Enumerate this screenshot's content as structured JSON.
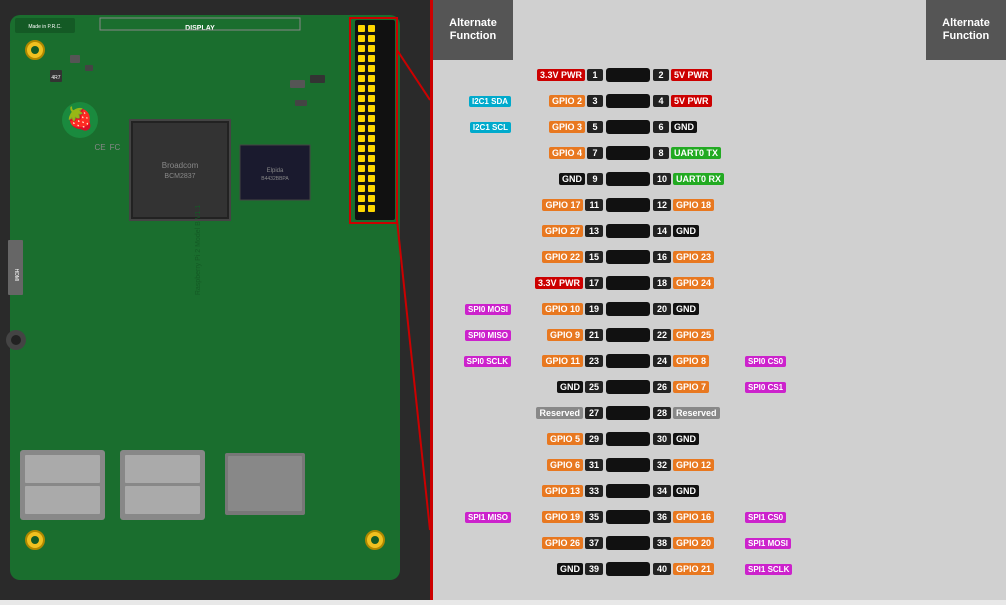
{
  "header": {
    "left_alt_func": "Alternate\nFunction",
    "right_alt_func": "Alternate\nFunction"
  },
  "pins": [
    {
      "left_alt": "",
      "left_label": "3.3V PWR",
      "left_color": "color-red",
      "left_num": "1",
      "right_num": "2",
      "right_label": "5V PWR",
      "right_color": "color-red2",
      "right_alt": ""
    },
    {
      "left_alt": "I2C1 SDA",
      "left_alt_color": "color-cyan",
      "left_label": "GPIO 2",
      "left_color": "color-orange",
      "left_num": "3",
      "right_num": "4",
      "right_label": "5V PWR",
      "right_color": "color-red2",
      "right_alt": ""
    },
    {
      "left_alt": "I2C1 SCL",
      "left_alt_color": "color-cyan",
      "left_label": "GPIO 3",
      "left_color": "color-orange",
      "left_num": "5",
      "right_num": "6",
      "right_label": "GND",
      "right_color": "color-black",
      "right_alt": ""
    },
    {
      "left_alt": "",
      "left_label": "GPIO 4",
      "left_color": "color-orange",
      "left_num": "7",
      "right_num": "8",
      "right_label": "UART0 TX",
      "right_color": "color-green",
      "right_alt": ""
    },
    {
      "left_alt": "",
      "left_label": "GND",
      "left_color": "color-black",
      "left_num": "9",
      "right_num": "10",
      "right_label": "UART0 RX",
      "right_color": "color-green",
      "right_alt": ""
    },
    {
      "left_alt": "",
      "left_label": "GPIO 17",
      "left_color": "color-orange",
      "left_num": "11",
      "right_num": "12",
      "right_label": "GPIO 18",
      "right_color": "color-orange",
      "right_alt": ""
    },
    {
      "left_alt": "",
      "left_label": "GPIO 27",
      "left_color": "color-orange",
      "left_num": "13",
      "right_num": "14",
      "right_label": "GND",
      "right_color": "color-black",
      "right_alt": ""
    },
    {
      "left_alt": "",
      "left_label": "GPIO 22",
      "left_color": "color-orange",
      "left_num": "15",
      "right_num": "16",
      "right_label": "GPIO 23",
      "right_color": "color-orange",
      "right_alt": ""
    },
    {
      "left_alt": "",
      "left_label": "3.3V PWR",
      "left_color": "color-red",
      "left_num": "17",
      "right_num": "18",
      "right_label": "GPIO 24",
      "right_color": "color-orange",
      "right_alt": ""
    },
    {
      "left_alt": "SPI0 MOSI",
      "left_alt_color": "color-magenta",
      "left_label": "GPIO 10",
      "left_color": "color-orange",
      "left_num": "19",
      "right_num": "20",
      "right_label": "GND",
      "right_color": "color-black",
      "right_alt": ""
    },
    {
      "left_alt": "SPI0 MISO",
      "left_alt_color": "color-magenta",
      "left_label": "GPIO 9",
      "left_color": "color-orange",
      "left_num": "21",
      "right_num": "22",
      "right_label": "GPIO 25",
      "right_color": "color-orange",
      "right_alt": ""
    },
    {
      "left_alt": "SPI0 SCLK",
      "left_alt_color": "color-magenta",
      "left_label": "GPIO 11",
      "left_color": "color-orange",
      "left_num": "23",
      "right_num": "24",
      "right_label": "GPIO 8",
      "right_color": "color-orange",
      "right_alt": "SPI0 CS0"
    },
    {
      "left_alt": "",
      "left_label": "GND",
      "left_color": "color-black",
      "left_num": "25",
      "right_num": "26",
      "right_label": "GPIO 7",
      "right_color": "color-orange",
      "right_alt": "SPI0 CS1"
    },
    {
      "left_alt": "",
      "left_label": "Reserved",
      "left_color": "color-gray",
      "left_num": "27",
      "right_num": "28",
      "right_label": "Reserved",
      "right_color": "color-gray",
      "right_alt": ""
    },
    {
      "left_alt": "",
      "left_label": "GPIO 5",
      "left_color": "color-orange",
      "left_num": "29",
      "right_num": "30",
      "right_label": "GND",
      "right_color": "color-black",
      "right_alt": ""
    },
    {
      "left_alt": "",
      "left_label": "GPIO 6",
      "left_color": "color-orange",
      "left_num": "31",
      "right_num": "32",
      "right_label": "GPIO 12",
      "right_color": "color-orange",
      "right_alt": ""
    },
    {
      "left_alt": "",
      "left_label": "GPIO 13",
      "left_color": "color-orange",
      "left_num": "33",
      "right_num": "34",
      "right_label": "GND",
      "right_color": "color-black",
      "right_alt": ""
    },
    {
      "left_alt": "SPI1 MISO",
      "left_alt_color": "color-magenta",
      "left_label": "GPIO 19",
      "left_color": "color-orange",
      "left_num": "35",
      "right_num": "36",
      "right_label": "GPIO 16",
      "right_color": "color-orange",
      "right_alt": "SPI1 CS0"
    },
    {
      "left_alt": "",
      "left_label": "GPIO 26",
      "left_color": "color-orange",
      "left_num": "37",
      "right_num": "38",
      "right_label": "GPIO 20",
      "right_color": "color-orange",
      "right_alt": "SPI1 MOSI"
    },
    {
      "left_alt": "",
      "left_label": "GND",
      "left_color": "color-black",
      "left_num": "39",
      "right_num": "40",
      "right_label": "GPIO 21",
      "right_color": "color-orange",
      "right_alt": "SPI1 SCLK"
    }
  ]
}
